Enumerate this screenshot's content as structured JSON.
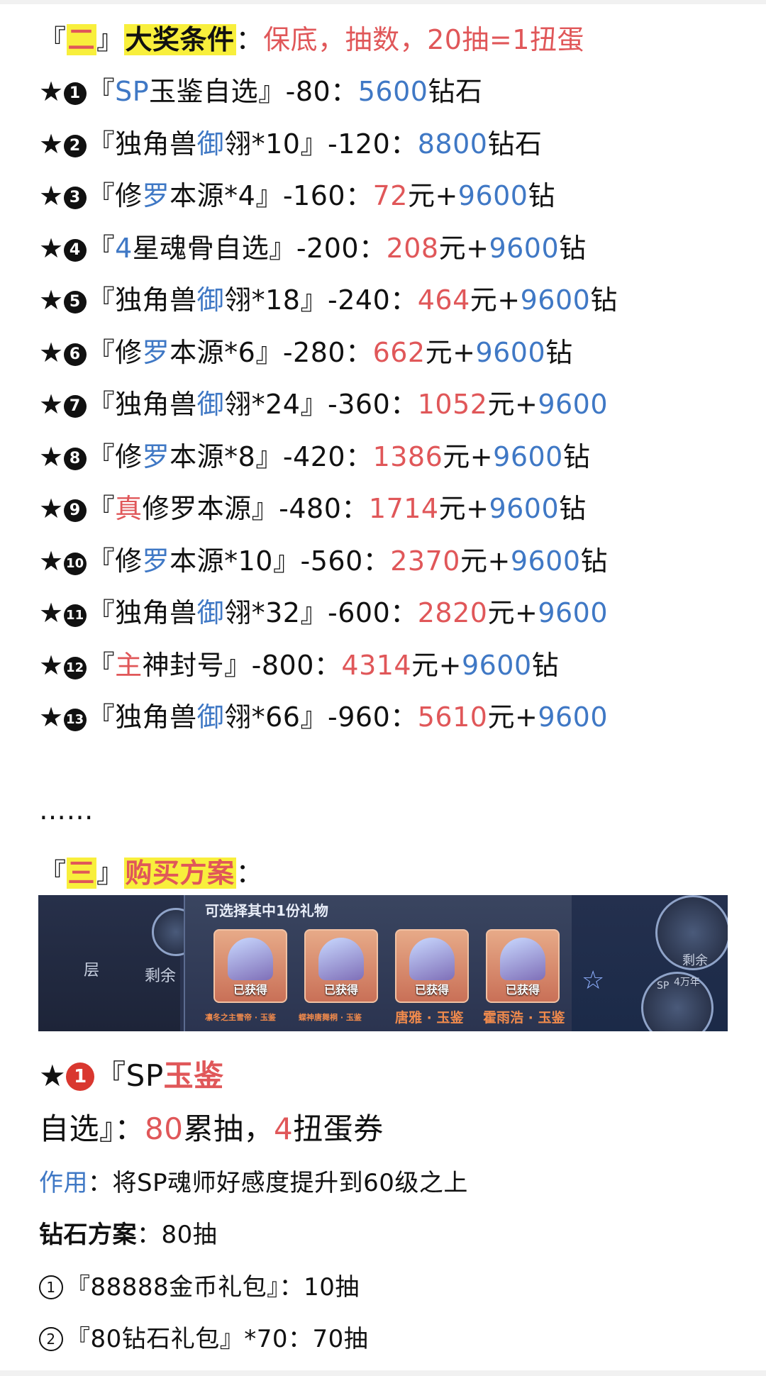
{
  "section2": {
    "bracket_open": "『",
    "num": "二",
    "bracket_close": "』",
    "title": "大奖条件",
    "colon": "：",
    "desc": "保底，抽数，20抽=1扭蛋"
  },
  "rewards": [
    {
      "prefix": "★",
      "index": "1",
      "open": "『",
      "parts": [
        {
          "t": "SP",
          "c": "blue"
        },
        {
          "t": "玉鉴自选",
          "c": "dark"
        }
      ],
      "close": "』",
      "pull": "-80：",
      "price": [
        {
          "t": "5600",
          "c": "blue"
        },
        {
          "t": "钻石",
          "c": "dark"
        }
      ]
    },
    {
      "prefix": "★",
      "index": "2",
      "open": "『",
      "parts": [
        {
          "t": "独角兽",
          "c": "dark"
        },
        {
          "t": "御",
          "c": "blue"
        },
        {
          "t": "翎*10",
          "c": "dark"
        }
      ],
      "close": "』",
      "pull": "-120：",
      "price": [
        {
          "t": "8800",
          "c": "blue"
        },
        {
          "t": "钻石",
          "c": "dark"
        }
      ]
    },
    {
      "prefix": "★",
      "index": "3",
      "open": "『",
      "parts": [
        {
          "t": "修",
          "c": "dark"
        },
        {
          "t": "罗",
          "c": "blue"
        },
        {
          "t": "本源*4",
          "c": "dark"
        }
      ],
      "close": "』",
      "pull": "-160：",
      "price": [
        {
          "t": "72",
          "c": "red"
        },
        {
          "t": "元+",
          "c": "dark"
        },
        {
          "t": "9600",
          "c": "blue"
        },
        {
          "t": "钻",
          "c": "dark"
        }
      ]
    },
    {
      "prefix": "★",
      "index": "4",
      "open": "『",
      "parts": [
        {
          "t": "4",
          "c": "blue"
        },
        {
          "t": "星魂骨自选",
          "c": "dark"
        }
      ],
      "close": "』",
      "pull": "-200：",
      "price": [
        {
          "t": "208",
          "c": "red"
        },
        {
          "t": "元+",
          "c": "dark"
        },
        {
          "t": "9600",
          "c": "blue"
        },
        {
          "t": "钻",
          "c": "dark"
        }
      ]
    },
    {
      "prefix": "★",
      "index": "5",
      "open": "『",
      "parts": [
        {
          "t": "独角兽",
          "c": "dark"
        },
        {
          "t": "御",
          "c": "blue"
        },
        {
          "t": "翎*18",
          "c": "dark"
        }
      ],
      "close": "』",
      "pull": "-240：",
      "price": [
        {
          "t": "464",
          "c": "red"
        },
        {
          "t": "元+",
          "c": "dark"
        },
        {
          "t": "9600",
          "c": "blue"
        },
        {
          "t": "钻",
          "c": "dark"
        }
      ]
    },
    {
      "prefix": "★",
      "index": "6",
      "open": "『",
      "parts": [
        {
          "t": "修",
          "c": "dark"
        },
        {
          "t": "罗",
          "c": "blue"
        },
        {
          "t": "本源*6",
          "c": "dark"
        }
      ],
      "close": "』",
      "pull": "-280：",
      "price": [
        {
          "t": "662",
          "c": "red"
        },
        {
          "t": "元+",
          "c": "dark"
        },
        {
          "t": "9600",
          "c": "blue"
        },
        {
          "t": "钻",
          "c": "dark"
        }
      ]
    },
    {
      "prefix": "★",
      "index": "7",
      "open": "『",
      "parts": [
        {
          "t": "独角兽",
          "c": "dark"
        },
        {
          "t": "御",
          "c": "blue"
        },
        {
          "t": "翎*24",
          "c": "dark"
        }
      ],
      "close": "』",
      "pull": "-360：",
      "price": [
        {
          "t": "1052",
          "c": "red"
        },
        {
          "t": "元+",
          "c": "dark"
        },
        {
          "t": "9600",
          "c": "blue"
        }
      ]
    },
    {
      "prefix": "★",
      "index": "8",
      "open": "『",
      "parts": [
        {
          "t": "修",
          "c": "dark"
        },
        {
          "t": "罗",
          "c": "blue"
        },
        {
          "t": "本源*8",
          "c": "dark"
        }
      ],
      "close": "』",
      "pull": "-420：",
      "price": [
        {
          "t": "1386",
          "c": "red"
        },
        {
          "t": "元+",
          "c": "dark"
        },
        {
          "t": "9600",
          "c": "blue"
        },
        {
          "t": "钻",
          "c": "dark"
        }
      ]
    },
    {
      "prefix": "★",
      "index": "9",
      "open": "『",
      "parts": [
        {
          "t": "真",
          "c": "red"
        },
        {
          "t": "修罗本源",
          "c": "dark"
        }
      ],
      "close": "』",
      "pull": "-480：",
      "price": [
        {
          "t": "1714",
          "c": "red"
        },
        {
          "t": "元+",
          "c": "dark"
        },
        {
          "t": "9600",
          "c": "blue"
        },
        {
          "t": "钻",
          "c": "dark"
        }
      ]
    },
    {
      "prefix": "★",
      "index": "10",
      "open": "『",
      "parts": [
        {
          "t": "修",
          "c": "dark"
        },
        {
          "t": "罗",
          "c": "blue"
        },
        {
          "t": "本源*10",
          "c": "dark"
        }
      ],
      "close": "』",
      "pull": "-560：",
      "price": [
        {
          "t": "2370",
          "c": "red"
        },
        {
          "t": "元+",
          "c": "dark"
        },
        {
          "t": "9600",
          "c": "blue"
        },
        {
          "t": "钻",
          "c": "dark"
        }
      ]
    },
    {
      "prefix": "★",
      "index": "11",
      "open": "『",
      "parts": [
        {
          "t": "独角兽",
          "c": "dark"
        },
        {
          "t": "御",
          "c": "blue"
        },
        {
          "t": "翎*32",
          "c": "dark"
        }
      ],
      "close": "』",
      "pull": "-600：",
      "price": [
        {
          "t": "2820",
          "c": "red"
        },
        {
          "t": "元+",
          "c": "dark"
        },
        {
          "t": "9600",
          "c": "blue"
        }
      ]
    },
    {
      "prefix": "★",
      "index": "12",
      "open": "『",
      "parts": [
        {
          "t": "主",
          "c": "red"
        },
        {
          "t": "神封号",
          "c": "dark"
        }
      ],
      "close": "』",
      "pull": "-800：",
      "price": [
        {
          "t": "4314",
          "c": "red"
        },
        {
          "t": "元+",
          "c": "dark"
        },
        {
          "t": "9600",
          "c": "blue"
        },
        {
          "t": "钻",
          "c": "dark"
        }
      ]
    },
    {
      "prefix": "★",
      "index": "13",
      "open": "『",
      "parts": [
        {
          "t": "独角兽",
          "c": "dark"
        },
        {
          "t": "御",
          "c": "blue"
        },
        {
          "t": "翎*66",
          "c": "dark"
        }
      ],
      "close": "』",
      "pull": "-960：",
      "price": [
        {
          "t": "5610",
          "c": "red"
        },
        {
          "t": "元+",
          "c": "dark"
        },
        {
          "t": "9600",
          "c": "blue"
        }
      ]
    }
  ],
  "ellipsis": "……",
  "section3": {
    "bracket_open": "『",
    "num": "三",
    "bracket_close": "』",
    "title": "购买方案",
    "colon": "："
  },
  "banner": {
    "panel_title": "可选择其中1份礼物",
    "gift_status": "已获得",
    "captions": [
      "凛冬之主雪帝 · 玉鉴",
      "蝶神唐舞桐 · 玉鉴",
      "唐雅 · 玉鉴",
      "霍雨浩 · 玉鉴"
    ],
    "left_text_1": "层",
    "left_text_2": "剩余",
    "right_text_1": "剩余",
    "right_text_2": "4万年",
    "right_text_3": "SP"
  },
  "plan1": {
    "star": "★",
    "index": "1",
    "line1_prefix": "『SP",
    "line1_red": "玉鉴",
    "line2_a": "自选』：",
    "line2_num1": "80",
    "line2_b": "累抽，",
    "line2_num2": "4",
    "line2_c": "扭蛋券",
    "effect_label": "作用",
    "effect_text": "：将SP魂师好感度提升到60级之上",
    "diamond_label": "钻石方案",
    "diamond_text": "：80抽",
    "opt1_index": "1",
    "opt1_text": "『88888金币礼包』：10抽",
    "opt2_index": "2",
    "opt2_text": "『80钻石礼包』*70：70抽"
  }
}
